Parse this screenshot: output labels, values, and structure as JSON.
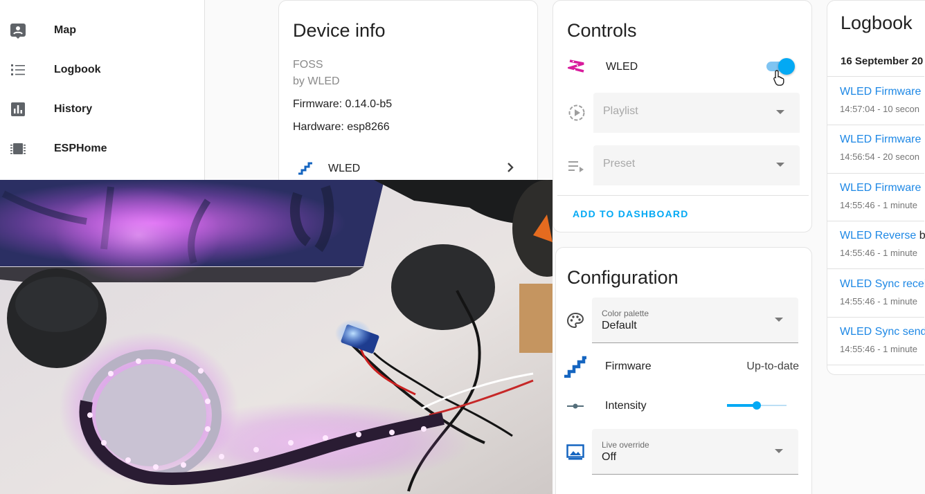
{
  "sidebar": {
    "items": [
      {
        "label": "Map",
        "icon": "map-icon"
      },
      {
        "label": "Logbook",
        "icon": "logbook-icon"
      },
      {
        "label": "History",
        "icon": "history-icon"
      },
      {
        "label": "ESPHome",
        "icon": "esphome-icon"
      }
    ]
  },
  "device_info": {
    "title": "Device info",
    "model": "FOSS",
    "manufacturer": "by WLED",
    "firmware": "Firmware: 0.14.0-b5",
    "hardware": "Hardware: esp8266",
    "link_label": "WLED"
  },
  "controls": {
    "title": "Controls",
    "wled_label": "WLED",
    "wled_on": true,
    "playlist_placeholder": "Playlist",
    "preset_placeholder": "Preset",
    "add_to_dashboard": "ADD TO DASHBOARD"
  },
  "configuration": {
    "title": "Configuration",
    "color_palette_label": "Color palette",
    "color_palette_value": "Default",
    "firmware_label": "Firmware",
    "firmware_value": "Up-to-date",
    "intensity_label": "Intensity",
    "intensity_value": 0.5,
    "live_override_label": "Live override",
    "live_override_value": "Off"
  },
  "logbook": {
    "title": "Logbook",
    "date": "16 September 20",
    "entries": [
      {
        "title": "WLED Firmware",
        "time": "14:57:04 - 10 secon"
      },
      {
        "title": "WLED Firmware",
        "time": "14:56:54 - 20 secon"
      },
      {
        "title": "WLED Firmware",
        "time": "14:55:46 - 1 minute"
      },
      {
        "title": "WLED Reverse",
        "suffix": " bo",
        "time": "14:55:46 - 1 minute"
      },
      {
        "title": "WLED Sync recei",
        "time": "14:55:46 - 1 minute"
      },
      {
        "title": "WLED Sync send",
        "time": "14:55:46 - 1 minute"
      }
    ]
  },
  "colors": {
    "accent": "#03a9f4",
    "link": "#1e88e5",
    "wled_magenta": "#d81b9c",
    "firmware_blue": "#1565c0"
  }
}
